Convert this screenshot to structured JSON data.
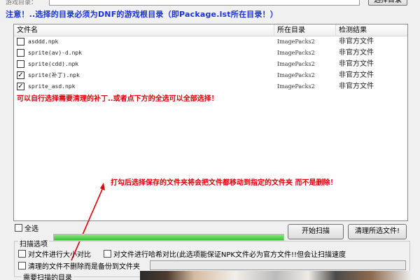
{
  "top": {
    "label": "游戏目录：",
    "path_value": "",
    "browse_button": "选择目录"
  },
  "notice": "注意！..选择的目录必须为DNF的游戏根目录（即Package.lst所在目录！）",
  "table": {
    "columns": [
      "文件名",
      "所在目录",
      "检测结果"
    ],
    "rows": [
      {
        "checked": false,
        "name": "asddd.npk",
        "dir": "ImagePacks2",
        "result": "非官方文件"
      },
      {
        "checked": false,
        "name": "sprite(av)-d.npk",
        "dir": "ImagePacks2",
        "result": "非官方文件"
      },
      {
        "checked": false,
        "name": "sprite(cdd).npk",
        "dir": "ImagePacks2",
        "result": "非官方文件"
      },
      {
        "checked": true,
        "name": "sprite(补丁).npk",
        "dir": "ImagePacks2",
        "result": "非官方文件"
      },
      {
        "checked": true,
        "name": "sprite_asd.npk",
        "dir": "ImagePacks2",
        "result": "非官方文件"
      }
    ],
    "check_mark": "✓"
  },
  "hint_select": "可以自行选择需要清理的补丁..或者点下方的全选可以全部选择！",
  "hint_move": "打勾后选择保存的文件夹将会把文件都移动到指定的文件夹  而不是删除！",
  "select_all_label": "全选",
  "progress_fraction": 1.0,
  "start_scan_button": "开始扫描",
  "clean_selected_button": "清理所选文件!",
  "scan_options": {
    "title": "扫描选项",
    "opt_size": "对文件进行大小对比",
    "opt_hash": "对文件进行哈希对比(此选项能保证NPK文件必为官方文件!!但会让扫描速度",
    "opt_backup": "清理的文件不删除而是备份到文件夹"
  },
  "scan_dir_title": "需要扫描的目录",
  "colors": {
    "notice": "#1a33d6",
    "hint": "#e0000a",
    "arrow": "#e0000a",
    "progress": "#35c535"
  }
}
